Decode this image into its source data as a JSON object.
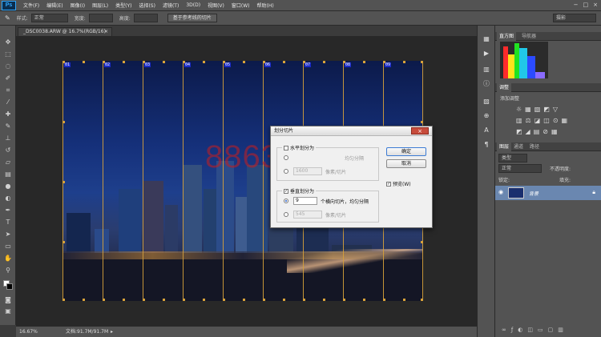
{
  "menubar": {
    "logo": "Ps",
    "items": [
      "文件(F)",
      "编辑(E)",
      "图像(I)",
      "图层(L)",
      "类型(Y)",
      "选择(S)",
      "滤镜(T)",
      "3D(D)",
      "视图(V)",
      "窗口(W)",
      "帮助(H)"
    ],
    "window_controls": [
      "−",
      "□",
      "×"
    ]
  },
  "options": {
    "style_label": "样式:",
    "style_value": "正常",
    "width_label": "宽度:",
    "height_label": "高度:",
    "slices_button": "基于参考线的切片",
    "workspace": "摄影"
  },
  "document": {
    "tab_title": "_DSC0038.ARW @ 16.7%(RGB/16)",
    "zoom": "16.67%",
    "doc_info": "文档:91.7M/91.7M",
    "slice_labels": [
      "01",
      "02",
      "03",
      "04",
      "05",
      "06",
      "07",
      "08",
      "09"
    ]
  },
  "right_panels": {
    "histogram_tabs": [
      "直方图",
      "导航器"
    ],
    "adjust_tabs": [
      "调整"
    ],
    "adjust_title": "添加调整",
    "layers_tabs": [
      "图层",
      "通道",
      "路径"
    ],
    "layer_filter": "类型",
    "blend_mode": "正常",
    "opacity_label": "不透明度:",
    "lock_label": "锁定:",
    "fill_label": "填充:",
    "layer_name": "背景"
  },
  "dialog": {
    "title": "划分切片",
    "horizontal_label": "水平划分为",
    "horizontal_value": "1600",
    "horizontal_unit": "像素/切片",
    "horizontal_evenly": "均匀分隔",
    "vertical_label": "垂直划分为",
    "vertical_count": "9",
    "vertical_count_unit": "个横向切片，均匀分隔",
    "vertical_pixels": "545",
    "vertical_pixels_unit": "像素/切片",
    "ok": "确定",
    "cancel": "取消",
    "preview": "预览(W)"
  },
  "watermark": "886396"
}
